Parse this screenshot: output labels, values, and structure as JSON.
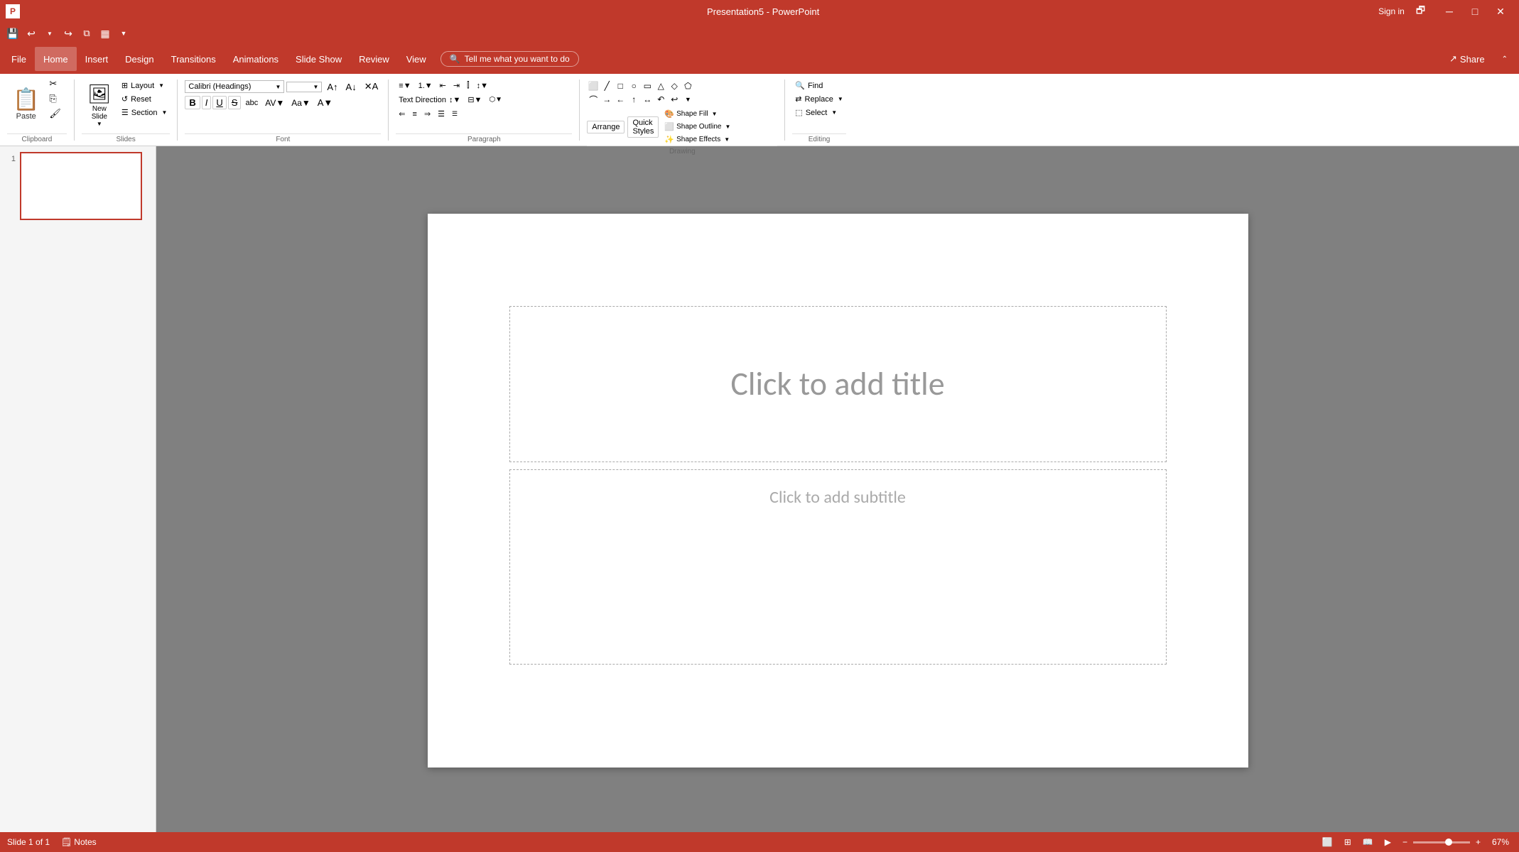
{
  "titlebar": {
    "title": "Presentation5 - PowerPoint",
    "signin": "Sign in",
    "restore_icon": "🗗",
    "minimize_icon": "─",
    "maximize_icon": "□",
    "close_icon": "✕"
  },
  "menubar": {
    "items": [
      "File",
      "Home",
      "Insert",
      "Design",
      "Transitions",
      "Animations",
      "Slide Show",
      "Review",
      "View"
    ],
    "tell_me": "Tell me what you want to do",
    "share": "Share"
  },
  "ribbon": {
    "clipboard_group": "Clipboard",
    "paste_label": "Paste",
    "slides_group": "Slides",
    "new_slide_label": "New\nSlide",
    "layout_label": "Layout",
    "reset_label": "Reset",
    "section_label": "Section",
    "font_group": "Font",
    "paragraph_group": "Paragraph",
    "drawing_group": "Drawing",
    "editing_group": "Editing",
    "shape_fill": "Shape Fill",
    "shape_outline": "Shape Outline",
    "shape_effects": "Shape Effects",
    "arrange": "Arrange",
    "quick_styles": "Quick\nStyles",
    "find": "Find",
    "replace": "Replace",
    "select": "Select",
    "align_text": "Align Text",
    "text_direction": "Text Direction",
    "convert_smartart": "Convert to SmartArt",
    "font_name": "",
    "font_size": ""
  },
  "quick_access": {
    "save": "💾",
    "undo": "↩",
    "redo": "↪",
    "customize": "▼"
  },
  "slide": {
    "number": "1",
    "title_placeholder": "Click to add title",
    "subtitle_placeholder": "Click to add subtitle"
  },
  "statusbar": {
    "slide_info": "Slide 1 of 1",
    "notes": "Notes",
    "zoom_level": "67%",
    "zoom_minus": "−",
    "zoom_plus": "+"
  }
}
